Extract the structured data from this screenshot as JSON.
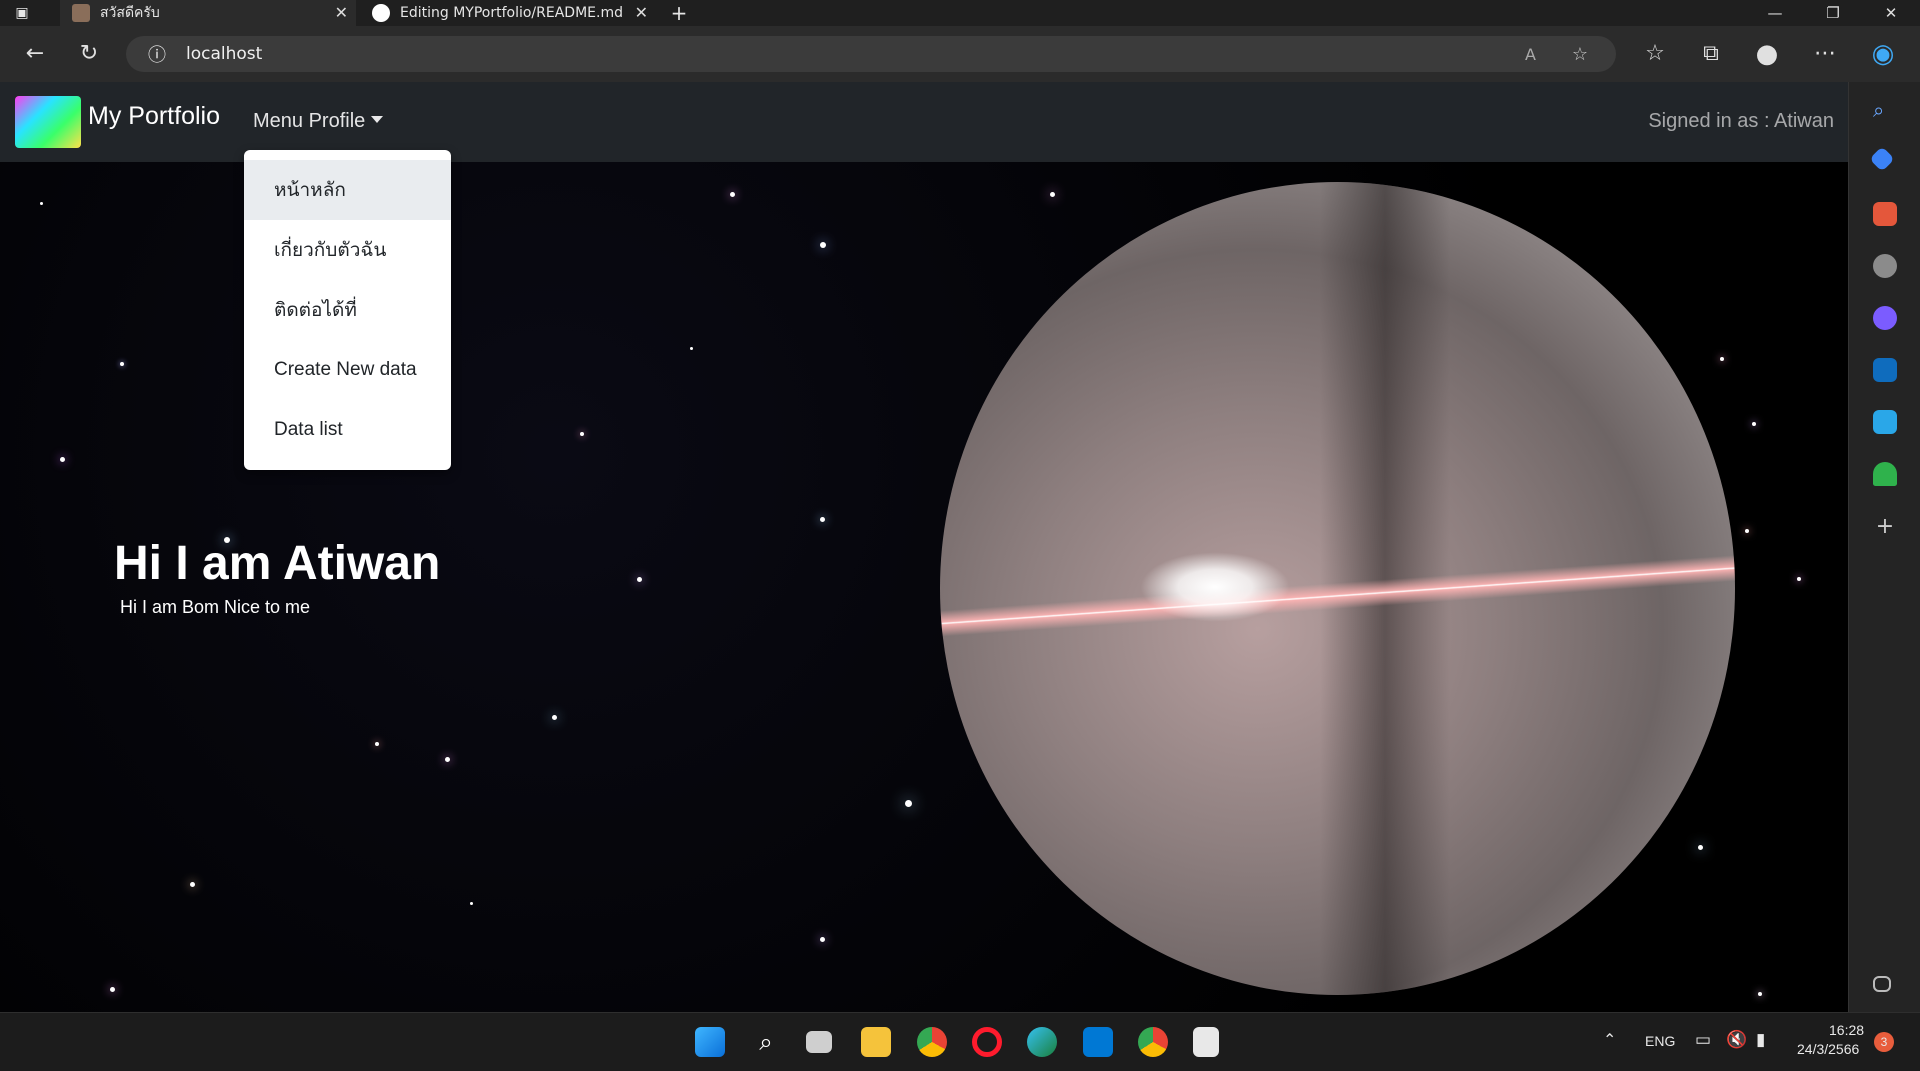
{
  "browser": {
    "tabs": [
      {
        "title": "สวัสดีครับ",
        "active": true
      },
      {
        "title": "Editing MYPortfolio/README.md",
        "active": false
      }
    ],
    "address": "localhost"
  },
  "navbar": {
    "brand": "My Portfolio",
    "menu_label": "Menu Profile",
    "signed_in": "Signed in as : Atiwan"
  },
  "dropdown": {
    "items": [
      {
        "label": "หน้าหลัก",
        "active": true
      },
      {
        "label": "เกี่ยวกับตัวฉัน",
        "active": false
      },
      {
        "label": "ติดต่อได้ที่",
        "active": false
      },
      {
        "label": "Create New data",
        "active": false
      },
      {
        "label": "Data list",
        "active": false
      }
    ]
  },
  "hero": {
    "title": "Hi I am Atiwan",
    "subtitle": "Hi I am Bom Nice to me"
  },
  "taskbar": {
    "lang": "ENG",
    "time": "16:28",
    "date": "24/3/2566",
    "notification_count": "3"
  },
  "colors": {
    "navbar_bg": "#212529",
    "dropdown_active_bg": "#e9ecef",
    "page_bg": "#000000"
  }
}
